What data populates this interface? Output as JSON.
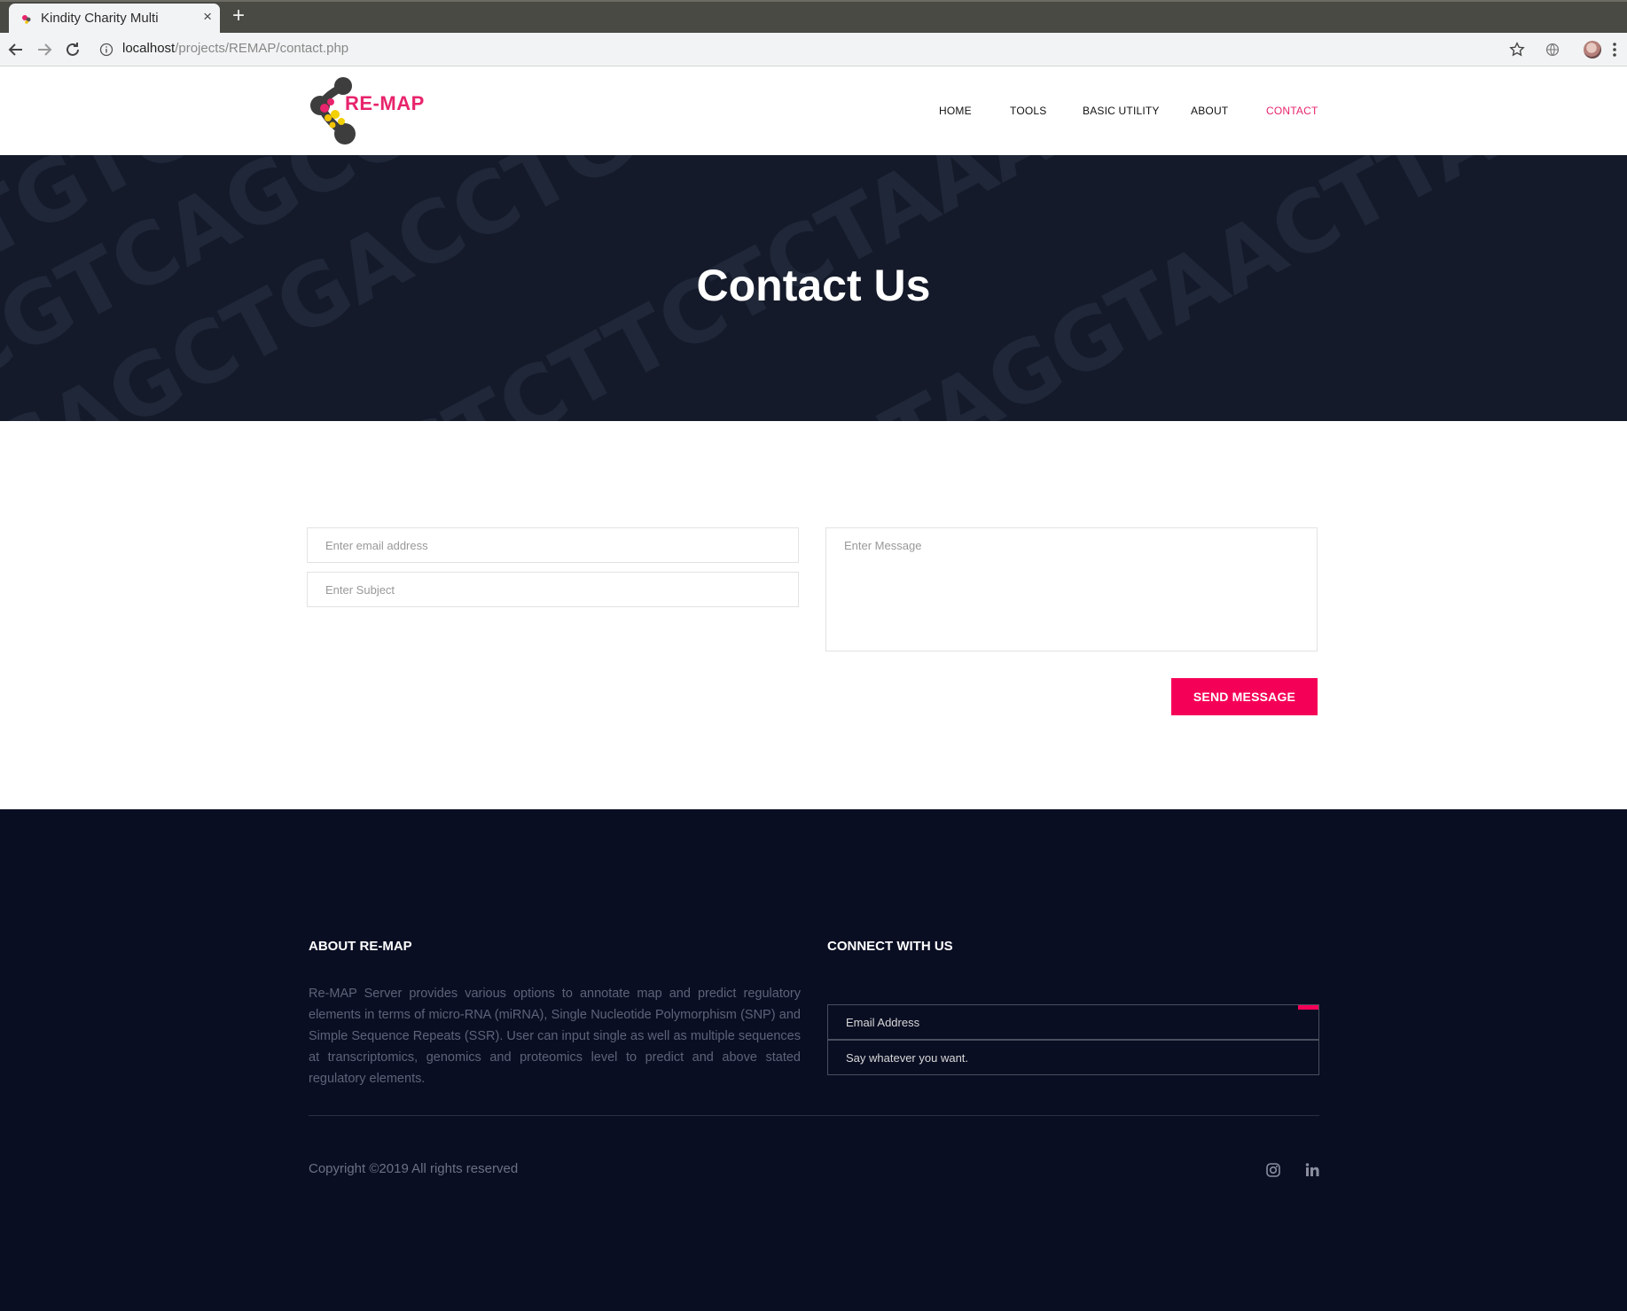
{
  "browser": {
    "tab_title": "Kindity Charity Multi",
    "tab_close": "×",
    "new_tab": "+",
    "url_host": "localhost",
    "url_path": "/projects/REMAP/contact.php"
  },
  "header": {
    "logo_text": "RE-MAP",
    "nav": [
      "HOME",
      "TOOLS",
      "BASIC UTILITY",
      "ABOUT",
      "CONTACT"
    ],
    "active_nav": "CONTACT"
  },
  "hero": {
    "title": "Contact Us"
  },
  "form": {
    "email_placeholder": "Enter email address",
    "subject_placeholder": "Enter Subject",
    "message_placeholder": "Enter Message",
    "submit_label": "SEND MESSAGE"
  },
  "footer": {
    "about_heading": "ABOUT RE-MAP",
    "about_text": "Re-MAP Server provides various options to annotate map and predict regulatory elements in terms of micro-RNA (miRNA), Single Nucleotide Polymorphism (SNP) and Simple Sequence Repeats (SSR). User can input single as well as multiple sequences at transcriptomics, genomics and proteomics level to predict and above stated regulatory elements.",
    "connect_heading": "CONNECT WITH US",
    "newsletter_email_placeholder": "Email Address",
    "newsletter_message_placeholder": "Say whatever you want.",
    "copyright": "Copyright ©2019 All rights reserved",
    "social": [
      "instagram-icon",
      "linkedin-icon"
    ]
  },
  "colors": {
    "accent": "#f50057",
    "nav_active": "#e8246c",
    "hero_bg": "#141a29",
    "footer_bg": "#0a0e23"
  }
}
